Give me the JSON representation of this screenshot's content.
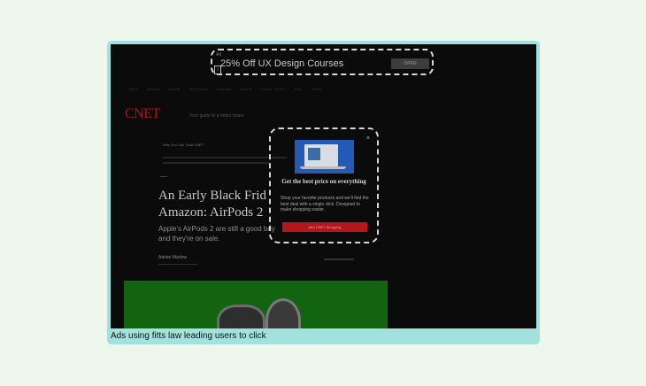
{
  "caption": "Ads using fitts law leading users to click",
  "top_ad": {
    "ad_badge": "Ad",
    "text": "25% Off UX Design Courses",
    "button_label": "OPEN"
  },
  "nav": {
    "items": [
      "Tech",
      "Money",
      "Home",
      "Wellness",
      "Energy",
      "Deals",
      "Cover Story",
      "Tips",
      "Video",
      "Tech"
    ]
  },
  "site": {
    "logo": "CNET",
    "tagline": "Your guide to a better future"
  },
  "article": {
    "breadcrumb": "Why You Can Trust CNET",
    "headline_line1": "An Early Black Frid",
    "headline_line2": "Amazon: AirPods 2",
    "dek": "Apple's AirPods 2 are still a good buy and they're on sale.",
    "author": "Adrian Marlow"
  },
  "popup": {
    "close_symbol": "×",
    "title": "Get the best price on everything",
    "body": "Shop your favorite products and we'll find the best deal with a single click. Designed to make shopping easier.",
    "cta_label": "Add CNET Shopping"
  },
  "colors": {
    "frame": "#a2e2de",
    "background": "#eef7ec",
    "logo_red": "#a1191c",
    "cta_red": "#b3161d",
    "hero_green": "#136411"
  }
}
